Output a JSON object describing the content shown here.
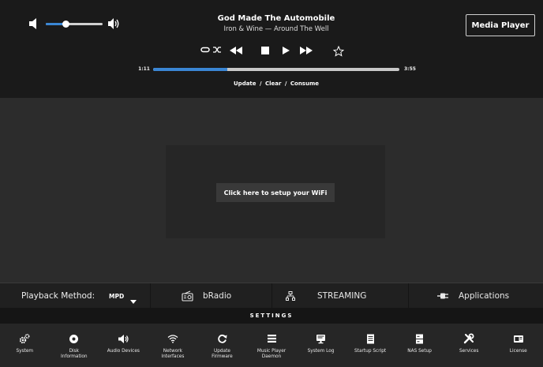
{
  "now_playing": {
    "title": "God Made The Automobile",
    "subtitle": "Iron & Wine — Around The Well"
  },
  "volume": {
    "level_percent": 35
  },
  "header": {
    "media_player_label": "Media Player"
  },
  "transport": {
    "icons": [
      "repeat-icon",
      "shuffle-icon",
      "previous-icon",
      "stop-icon",
      "play-icon",
      "next-icon",
      "favorite-star-icon"
    ]
  },
  "progress": {
    "current": "1:11",
    "total": "3:55",
    "percent": 30
  },
  "queue": {
    "update": "Update",
    "sep1": "/",
    "clear": "Clear",
    "sep2": "/",
    "consume": "Consume"
  },
  "wifi": {
    "button_label": "Click here to setup your WiFi"
  },
  "playback": {
    "label": "Playback Method:",
    "method": "MPD",
    "modes": [
      {
        "icon": "radio-icon",
        "label": "bRadio"
      },
      {
        "icon": "network-tree-icon",
        "label": "STREAMING"
      },
      {
        "icon": "plug-icon",
        "label": "Applications"
      }
    ]
  },
  "settings": {
    "title": "SETTINGS",
    "tiles": [
      {
        "icon": "gears-icon",
        "label": "System"
      },
      {
        "icon": "disk-icon",
        "label": "Disk\nInformation"
      },
      {
        "icon": "speaker-icon",
        "label": "Audio Devices"
      },
      {
        "icon": "wifi-icon",
        "label": "Network\nInterfaces"
      },
      {
        "icon": "refresh-icon",
        "label": "Update\nFirmware"
      },
      {
        "icon": "menu-icon",
        "label": "Music Player\nDaemon"
      },
      {
        "icon": "monitor-icon",
        "label": "System Log"
      },
      {
        "icon": "document-icon",
        "label": "Startup Script"
      },
      {
        "icon": "server-icon",
        "label": "NAS Setup"
      },
      {
        "icon": "tools-icon",
        "label": "Services"
      },
      {
        "icon": "license-card-icon",
        "label": "License"
      }
    ]
  },
  "colors": {
    "accent": "#3a86d4",
    "header_bg": "#1a1a1a",
    "body_bg": "#2c2c2c"
  }
}
